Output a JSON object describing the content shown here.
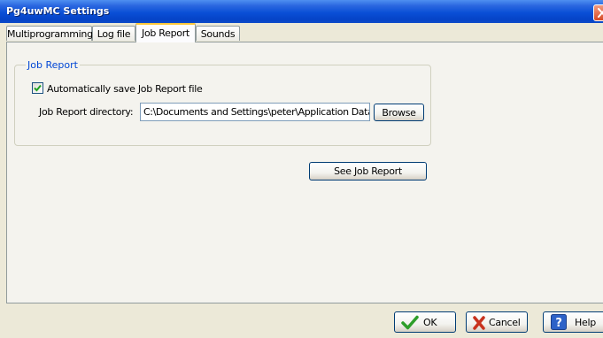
{
  "window": {
    "title": "Pg4uwMC Settings"
  },
  "tabs": [
    {
      "label": "Multiprogramming",
      "active": false
    },
    {
      "label": "Log file",
      "active": false
    },
    {
      "label": "Job Report",
      "active": true
    },
    {
      "label": "Sounds",
      "active": false
    }
  ],
  "job_report": {
    "group_title": "Job Report",
    "auto_save_label": "Automatically save Job Report file",
    "auto_save_checked": true,
    "directory_label": "Job Report directory:",
    "directory_value": "C:\\Documents and Settings\\peter\\Application Data",
    "browse_label": "Browse",
    "see_report_label": "See Job Report"
  },
  "footer": {
    "ok_label": "OK",
    "cancel_label": "Cancel",
    "help_label": "Help"
  },
  "icons": {
    "close": "close-icon",
    "ok": "check-icon",
    "cancel": "x-icon",
    "help": "question-icon"
  },
  "colors": {
    "titlebar": "#0a4fd6",
    "group_label": "#0046d5",
    "active_tab_highlight": "#ffc83c",
    "ok_check": "#2e9e2a",
    "cancel_x": "#c8321e",
    "help_bg": "#2d62c8"
  }
}
